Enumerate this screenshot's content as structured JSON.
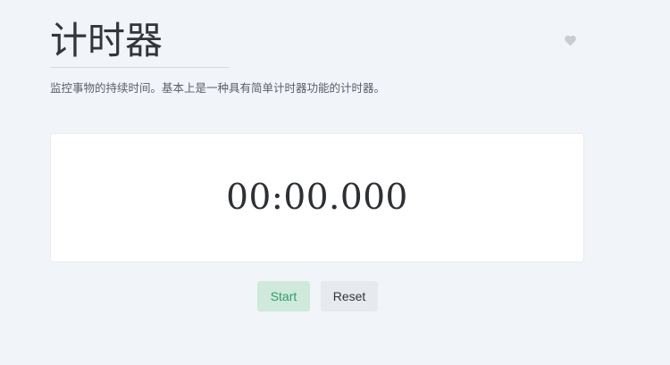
{
  "header": {
    "title": "计时器",
    "description": "监控事物的持续时间。基本上是一种具有简单计时器功能的计时器。"
  },
  "timer": {
    "display": "00:00.000"
  },
  "controls": {
    "start_label": "Start",
    "reset_label": "Reset"
  },
  "icons": {
    "favorite": "heart-icon"
  },
  "colors": {
    "background": "#f1f4f9",
    "card": "#ffffff",
    "start_bg": "#cfe9dc",
    "start_text": "#2f9d68",
    "reset_bg": "#e6e9ed",
    "heart": "#c9ccd1"
  }
}
